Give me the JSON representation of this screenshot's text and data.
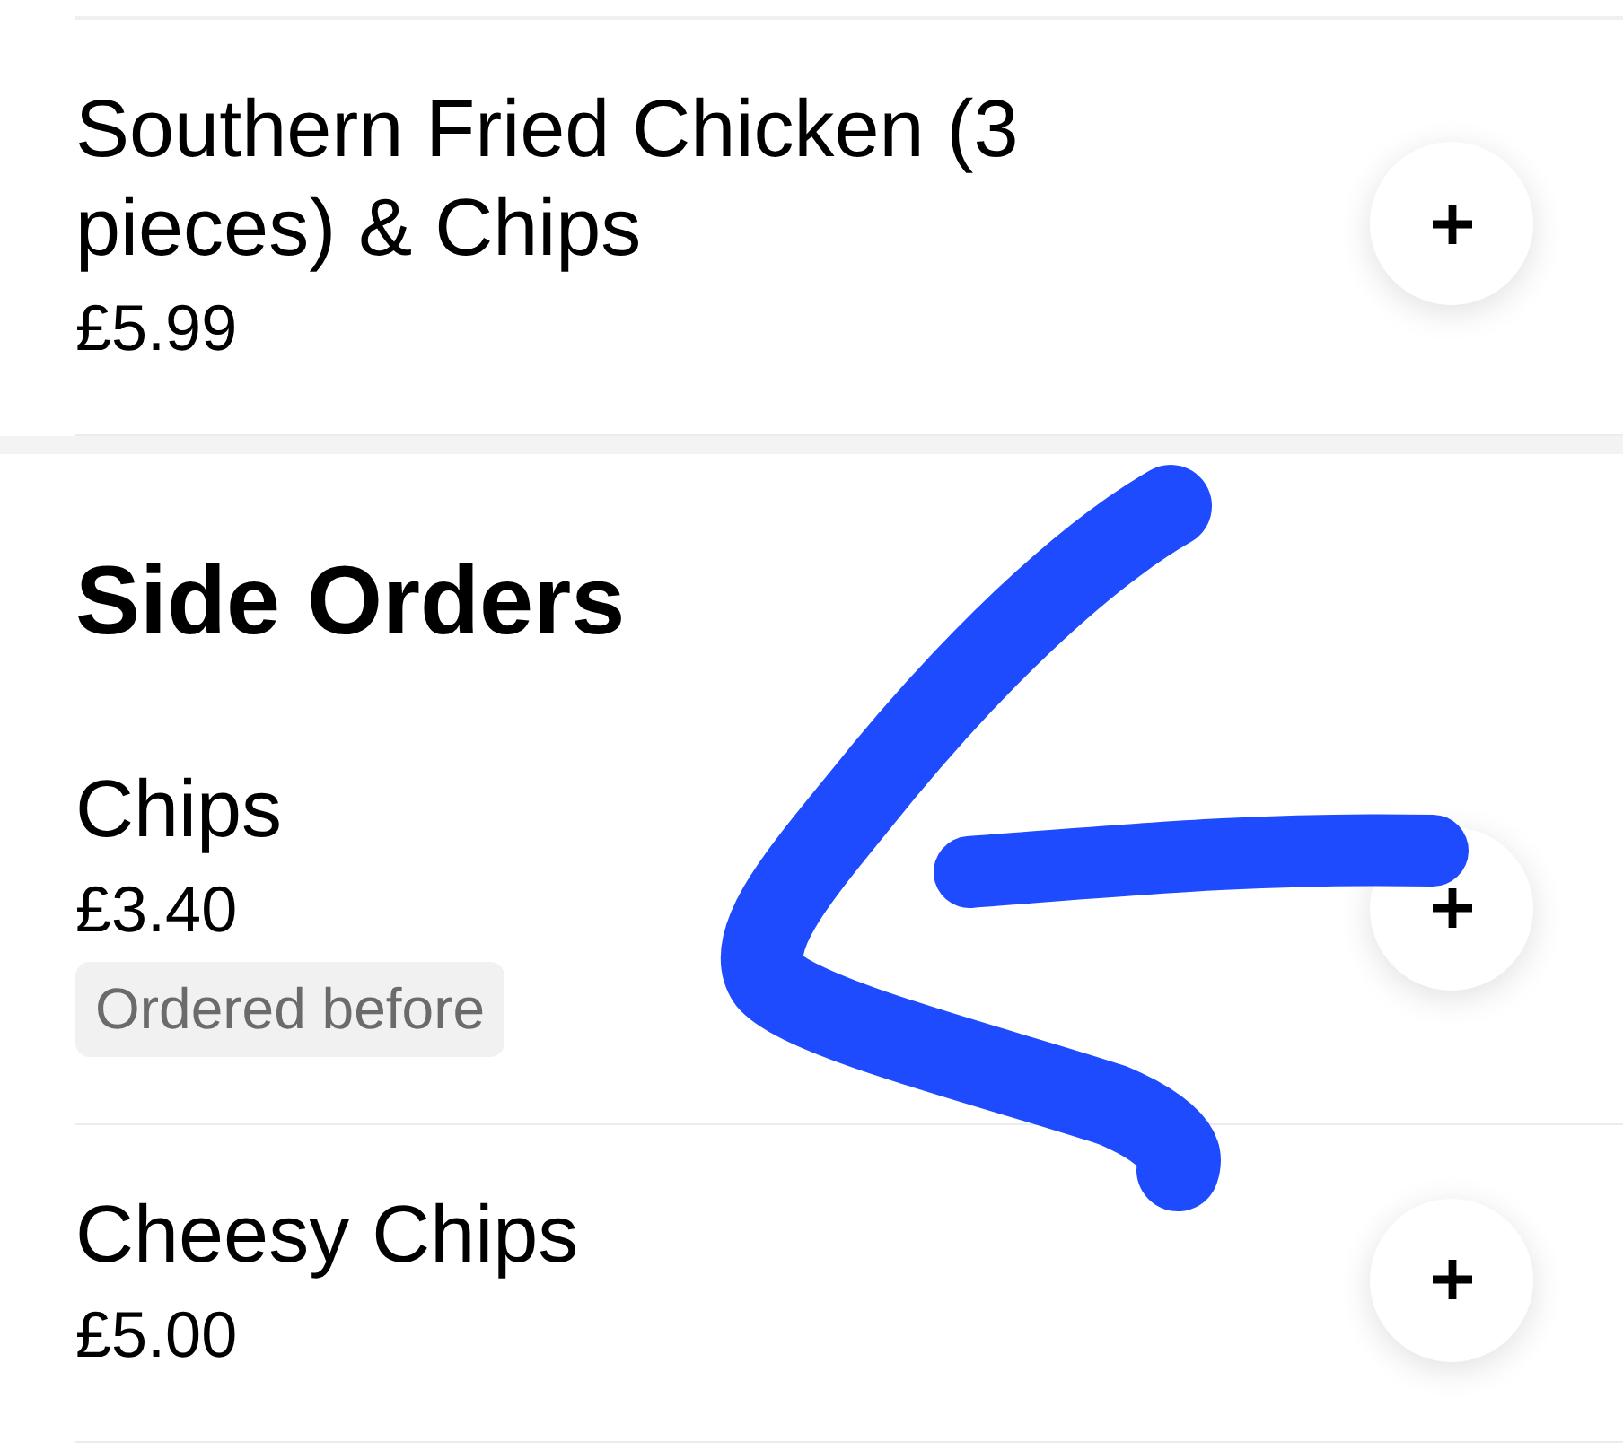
{
  "sections": [
    {
      "items": [
        {
          "name": "Southern Fried Chicken (3 pieces) & Chips",
          "price": "£5.99"
        }
      ]
    },
    {
      "title": "Side Orders",
      "items": [
        {
          "name": "Chips",
          "price": "£3.40",
          "badge": "Ordered before"
        },
        {
          "name": "Cheesy Chips",
          "price": "£5.00"
        }
      ]
    }
  ],
  "annotation": {
    "kind": "arrow"
  }
}
